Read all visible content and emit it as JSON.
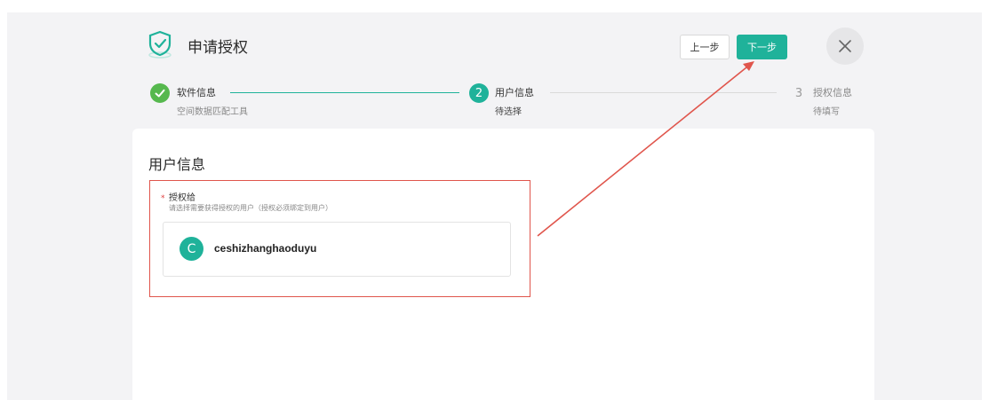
{
  "header": {
    "title": "申请授权",
    "prev_label": "上一步",
    "next_label": "下一步",
    "close_icon": "close-icon",
    "logo_icon": "shield-check-icon"
  },
  "steps": [
    {
      "index": "✓",
      "label": "软件信息",
      "sub": "空间数据匹配工具",
      "status": "done"
    },
    {
      "index": "2",
      "label": "用户信息",
      "sub": "待选择",
      "status": "active"
    },
    {
      "index": "3",
      "label": "授权信息",
      "sub": "待填写",
      "status": "pending"
    }
  ],
  "main": {
    "section_title": "用户信息",
    "field": {
      "required_mark": "*",
      "label": "授权给",
      "hint": "请选择需要获得授权的用户（授权必须绑定到用户）"
    },
    "user": {
      "avatar_letter": "C",
      "name": "ceshizhanghaoduyu"
    }
  },
  "colors": {
    "accent": "#1fb29a",
    "done": "#56b84e",
    "highlight": "#e0554c"
  }
}
